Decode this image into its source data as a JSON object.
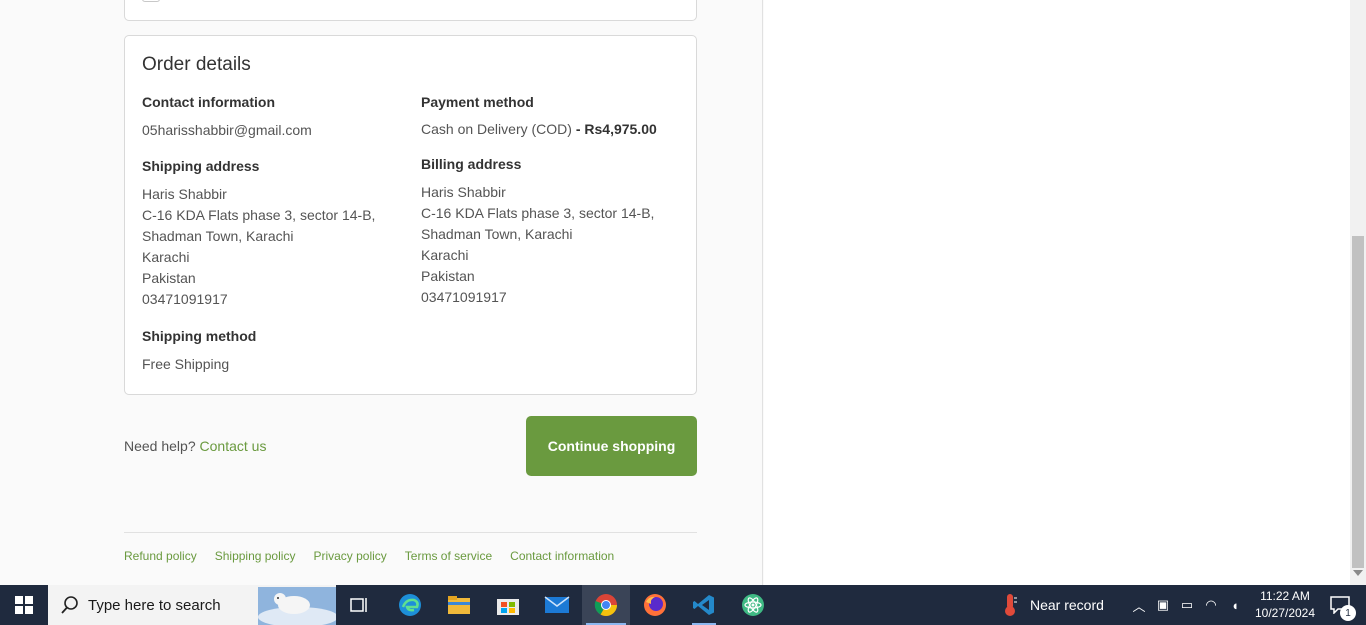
{
  "order_details": {
    "title": "Order details",
    "contact": {
      "heading": "Contact information",
      "email": "05harisshabbir@gmail.com"
    },
    "shipping_address": {
      "heading": "Shipping address",
      "lines": [
        "Haris Shabbir",
        "C-16 KDA Flats phase 3, sector 14-B,",
        "Shadman Town, Karachi",
        "Karachi",
        "Pakistan",
        "03471091917"
      ]
    },
    "shipping_method": {
      "heading": "Shipping method",
      "value": "Free Shipping"
    },
    "payment": {
      "heading": "Payment method",
      "method": "Cash on Delivery (COD)",
      "amount": "- Rs4,975.00"
    },
    "billing_address": {
      "heading": "Billing address",
      "lines": [
        "Haris Shabbir",
        "C-16 KDA Flats phase 3, sector 14-B,",
        "Shadman Town, Karachi",
        "Karachi",
        "Pakistan",
        "03471091917"
      ]
    }
  },
  "help": {
    "text": "Need help?",
    "link": "Contact us"
  },
  "continue_button": "Continue shopping",
  "footer_links": [
    "Refund policy",
    "Shipping policy",
    "Privacy policy",
    "Terms of service",
    "Contact information"
  ],
  "taskbar": {
    "search_placeholder": "Type here to search",
    "weather": "Near record",
    "time": "11:22 AM",
    "date": "10/27/2024",
    "notifications": "1",
    "apps": [
      "task-view-icon",
      "edge-icon",
      "file-explorer-icon",
      "store-icon",
      "mail-icon",
      "chrome-icon",
      "firefox-icon",
      "vscode-icon",
      "atom-icon"
    ]
  },
  "colors": {
    "accent": "#6a9a3f",
    "taskbar": "#1f2a3e"
  }
}
